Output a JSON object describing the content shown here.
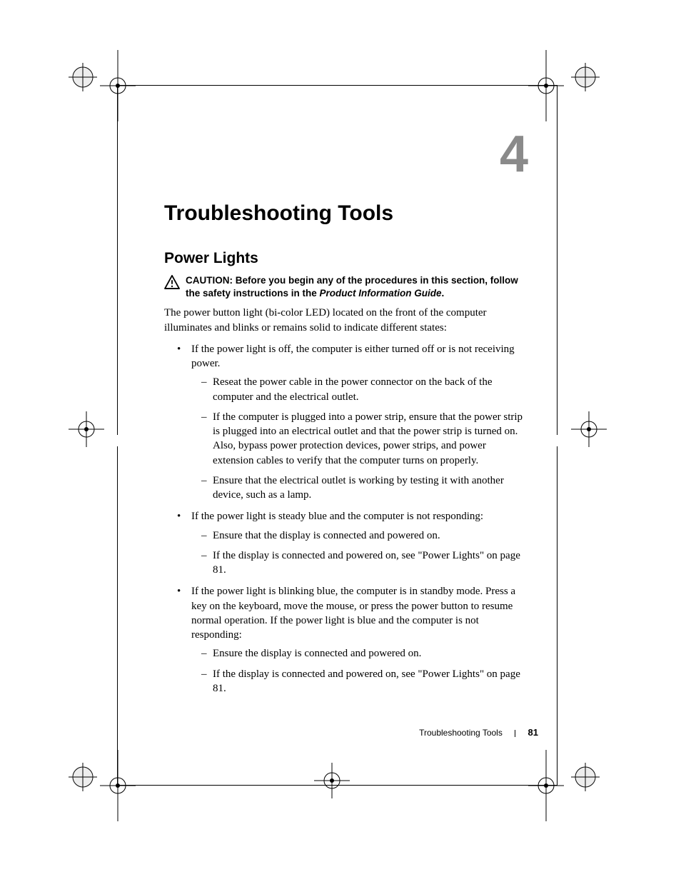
{
  "chapter_number": "4",
  "title": "Troubleshooting Tools",
  "section_heading": "Power Lights",
  "caution": {
    "label": "CAUTION:",
    "text_before": " Before you begin any of the procedures in this section, follow the safety instructions in the ",
    "italic": "Product Information Guide",
    "text_after": "."
  },
  "intro": "The power button light (bi-color LED) located on the front of the computer illuminates and blinks or remains solid to indicate different states:",
  "bullets": [
    {
      "text": "If the power light is off, the computer is either turned off or is not receiving power.",
      "sub": [
        "Reseat the power cable in the power connector on the back of the computer and the electrical outlet.",
        "If the computer is plugged into a power strip, ensure that the power strip is plugged into an electrical outlet and that the power strip is turned on. Also, bypass power protection devices, power strips, and power extension cables to verify that the computer turns on properly.",
        "Ensure that the electrical outlet is working by testing it with another device, such as a lamp."
      ]
    },
    {
      "text": "If the power light is steady blue and the computer is not responding:",
      "sub": [
        "Ensure that the display is connected and powered on.",
        "If the display is connected and powered on, see \"Power Lights\" on page 81."
      ]
    },
    {
      "text": "If the power light is blinking blue, the computer is in standby mode. Press a key on the keyboard, move the mouse, or press the power button to resume normal operation. If the power light is blue and the computer is not responding:",
      "sub": [
        "Ensure the display is connected and powered on.",
        "If the display is connected and powered on, see \"Power Lights\" on page 81."
      ]
    }
  ],
  "footer": {
    "section": "Troubleshooting Tools",
    "page": "81"
  }
}
